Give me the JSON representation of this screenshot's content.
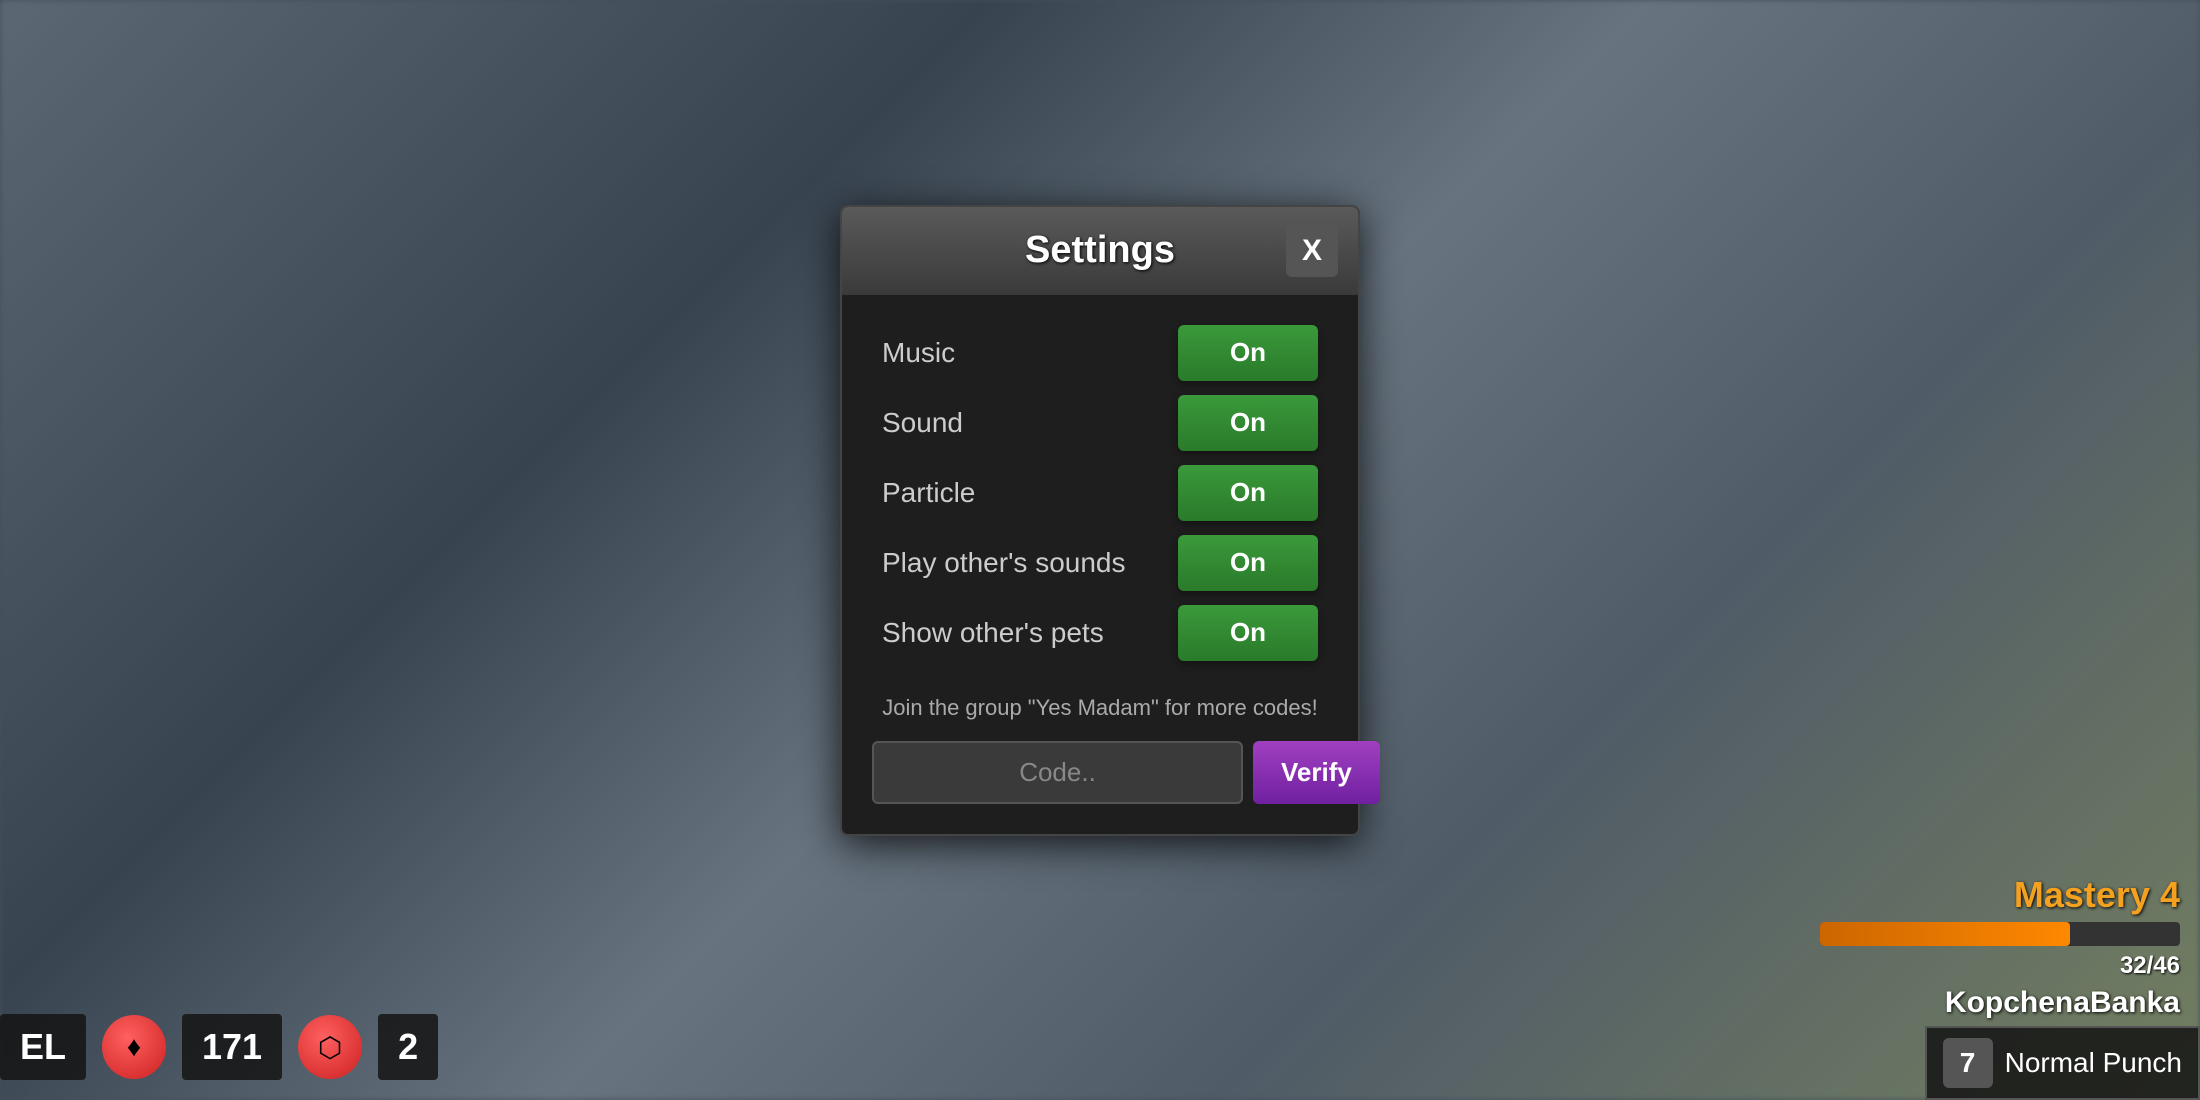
{
  "background": {
    "description": "Blurred game environment background"
  },
  "hud": {
    "level_label": "EL",
    "currency_amount": "171",
    "currency_count": "2",
    "mastery_title": "Mastery 4",
    "mastery_current": "32",
    "mastery_max": "46",
    "mastery_progress_text": "32/46",
    "mastery_fill_percent": 69.5,
    "player_name": "KopchenaBanka",
    "action_key": "7",
    "action_name": "Normal Punch"
  },
  "settings": {
    "title": "Settings",
    "close_label": "X",
    "rows": [
      {
        "label": "Music",
        "value": "On",
        "state": "on"
      },
      {
        "label": "Sound",
        "value": "On",
        "state": "on"
      },
      {
        "label": "Particle",
        "value": "On",
        "state": "on"
      },
      {
        "label": "Play other's sounds",
        "value": "On",
        "state": "on"
      },
      {
        "label": "Show other's pets",
        "value": "On",
        "state": "on"
      }
    ],
    "promo_text": "Join the group \"Yes Madam\" for more codes!",
    "code_placeholder": "Code..",
    "verify_label": "Verify"
  }
}
